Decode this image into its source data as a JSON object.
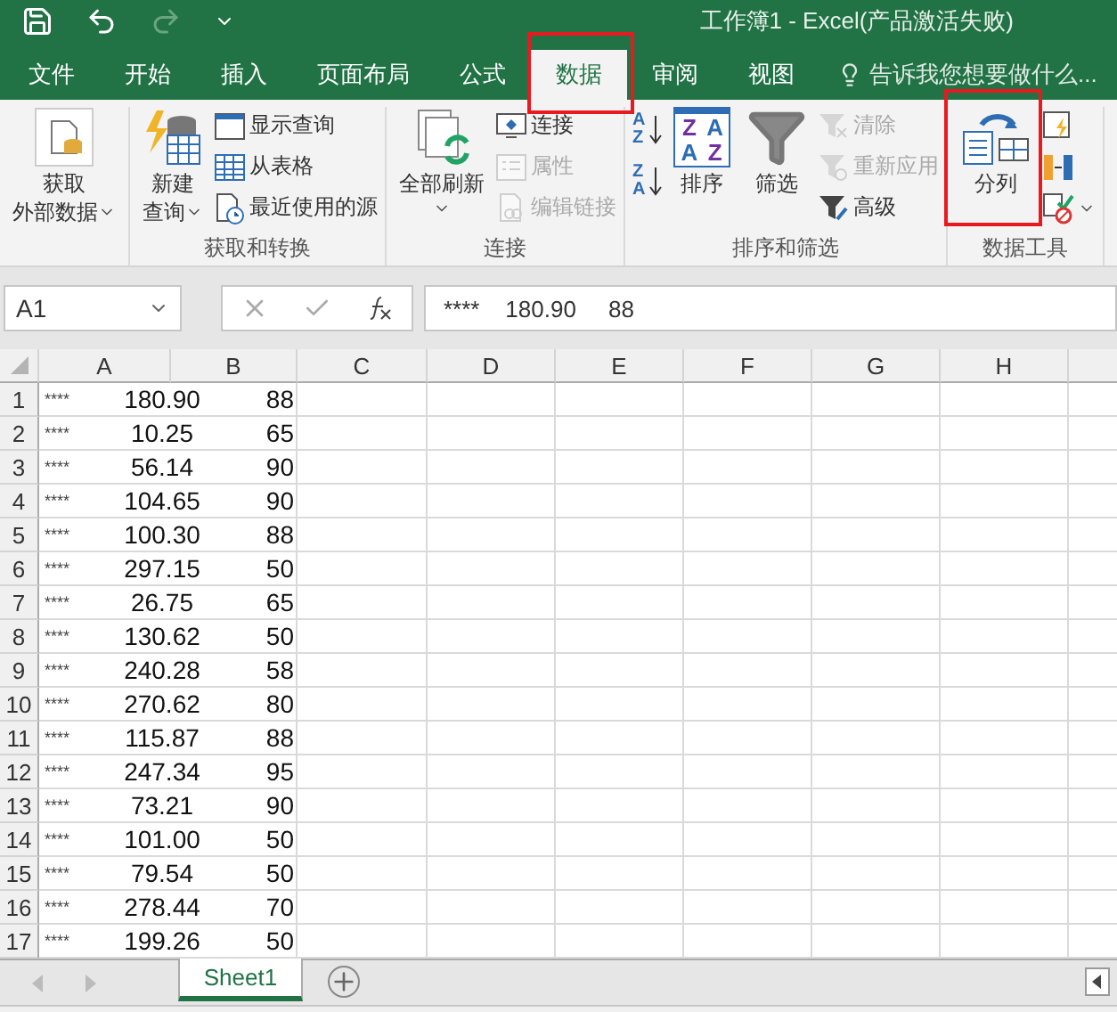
{
  "window": {
    "title": "工作簿1 - Excel(产品激活失败)"
  },
  "tabs": [
    {
      "label": "文件",
      "selected": false
    },
    {
      "label": "开始",
      "selected": false
    },
    {
      "label": "插入",
      "selected": false
    },
    {
      "label": "页面布局",
      "selected": false
    },
    {
      "label": "公式",
      "selected": false
    },
    {
      "label": "数据",
      "selected": true,
      "highlighted": true
    },
    {
      "label": "审阅",
      "selected": false
    },
    {
      "label": "视图",
      "selected": false
    }
  ],
  "tell_me": {
    "placeholder": "告诉我您想要做什么..."
  },
  "ribbon_groups": [
    {
      "columns": [
        {
          "kind": "large",
          "items": [
            {
              "lines": [
                "获取",
                "外部数据"
              ],
              "dropdown": true,
              "disabled": false
            }
          ]
        }
      ]
    },
    {
      "label": "获取和转换",
      "columns": [
        {
          "kind": "large",
          "items": [
            {
              "lines": [
                "新建",
                "查询"
              ],
              "dropdown": true,
              "disabled": false
            }
          ]
        },
        {
          "kind": "stack",
          "items": [
            {
              "label": "显示查询",
              "disabled": false
            },
            {
              "label": "从表格",
              "disabled": false
            },
            {
              "label": "最近使用的源",
              "disabled": false
            }
          ]
        }
      ]
    },
    {
      "label": "连接",
      "columns": [
        {
          "kind": "large",
          "items": [
            {
              "lines": [
                "全部刷新"
              ],
              "dropdown": true,
              "disabled": false
            }
          ]
        },
        {
          "kind": "stack",
          "items": [
            {
              "label": "连接",
              "disabled": false
            },
            {
              "label": "属性",
              "disabled": true
            },
            {
              "label": "编辑链接",
              "disabled": true
            }
          ]
        }
      ]
    },
    {
      "label": "排序和筛选",
      "columns": [
        {
          "kind": "stack",
          "items": [
            {
              "icon_text": [
                "A",
                "Z"
              ],
              "disabled": false
            },
            {
              "icon_text": [
                "Z",
                "A"
              ],
              "disabled": false
            }
          ]
        },
        {
          "kind": "large",
          "items": [
            {
              "lines": [
                "排序"
              ],
              "icon_text": [
                "Z",
                "A",
                "A",
                "Z"
              ],
              "disabled": false
            }
          ]
        },
        {
          "kind": "large",
          "items": [
            {
              "lines": [
                "筛选"
              ],
              "disabled": false
            }
          ]
        },
        {
          "kind": "stack",
          "items": [
            {
              "label": "清除",
              "disabled": true
            },
            {
              "label": "重新应用",
              "disabled": true
            },
            {
              "label": "高级",
              "disabled": false
            }
          ]
        }
      ]
    },
    {
      "label": "数据工具",
      "columns": [
        {
          "kind": "large",
          "items": [
            {
              "lines": [
                "分列"
              ],
              "disabled": false,
              "highlighted": true
            }
          ]
        },
        {
          "kind": "stack",
          "items": [
            {
              "disabled": false
            },
            {
              "disabled": false
            },
            {
              "disabled": false,
              "dropdown": true
            }
          ]
        }
      ]
    }
  ],
  "name_box": {
    "value": "A1"
  },
  "formula_bar": {
    "value": "****    180.90     88"
  },
  "columns": [
    "A",
    "B",
    "C",
    "D",
    "E",
    "F",
    "G",
    "H"
  ],
  "rows": [
    {
      "number": "1",
      "stars": "****",
      "value": "180.90",
      "score": "88"
    },
    {
      "number": "2",
      "stars": "****",
      "value": "10.25",
      "score": "65"
    },
    {
      "number": "3",
      "stars": "****",
      "value": "56.14",
      "score": "90"
    },
    {
      "number": "4",
      "stars": "****",
      "value": "104.65",
      "score": "90"
    },
    {
      "number": "5",
      "stars": "****",
      "value": "100.30",
      "score": "88"
    },
    {
      "number": "6",
      "stars": "****",
      "value": "297.15",
      "score": "50"
    },
    {
      "number": "7",
      "stars": "****",
      "value": "26.75",
      "score": "65"
    },
    {
      "number": "8",
      "stars": "****",
      "value": "130.62",
      "score": "50"
    },
    {
      "number": "9",
      "stars": "****",
      "value": "240.28",
      "score": "58"
    },
    {
      "number": "10",
      "stars": "****",
      "value": "270.62",
      "score": "80"
    },
    {
      "number": "11",
      "stars": "****",
      "value": "115.87",
      "score": "88"
    },
    {
      "number": "12",
      "stars": "****",
      "value": "247.34",
      "score": "95"
    },
    {
      "number": "13",
      "stars": "****",
      "value": "73.21",
      "score": "90"
    },
    {
      "number": "14",
      "stars": "****",
      "value": "101.00",
      "score": "50"
    },
    {
      "number": "15",
      "stars": "****",
      "value": "79.54",
      "score": "50"
    },
    {
      "number": "16",
      "stars": "****",
      "value": "278.44",
      "score": "70"
    },
    {
      "number": "17",
      "stars": "****",
      "value": "199.26",
      "score": "50"
    }
  ],
  "sheets": [
    {
      "name": "Sheet1",
      "selected": true
    }
  ]
}
